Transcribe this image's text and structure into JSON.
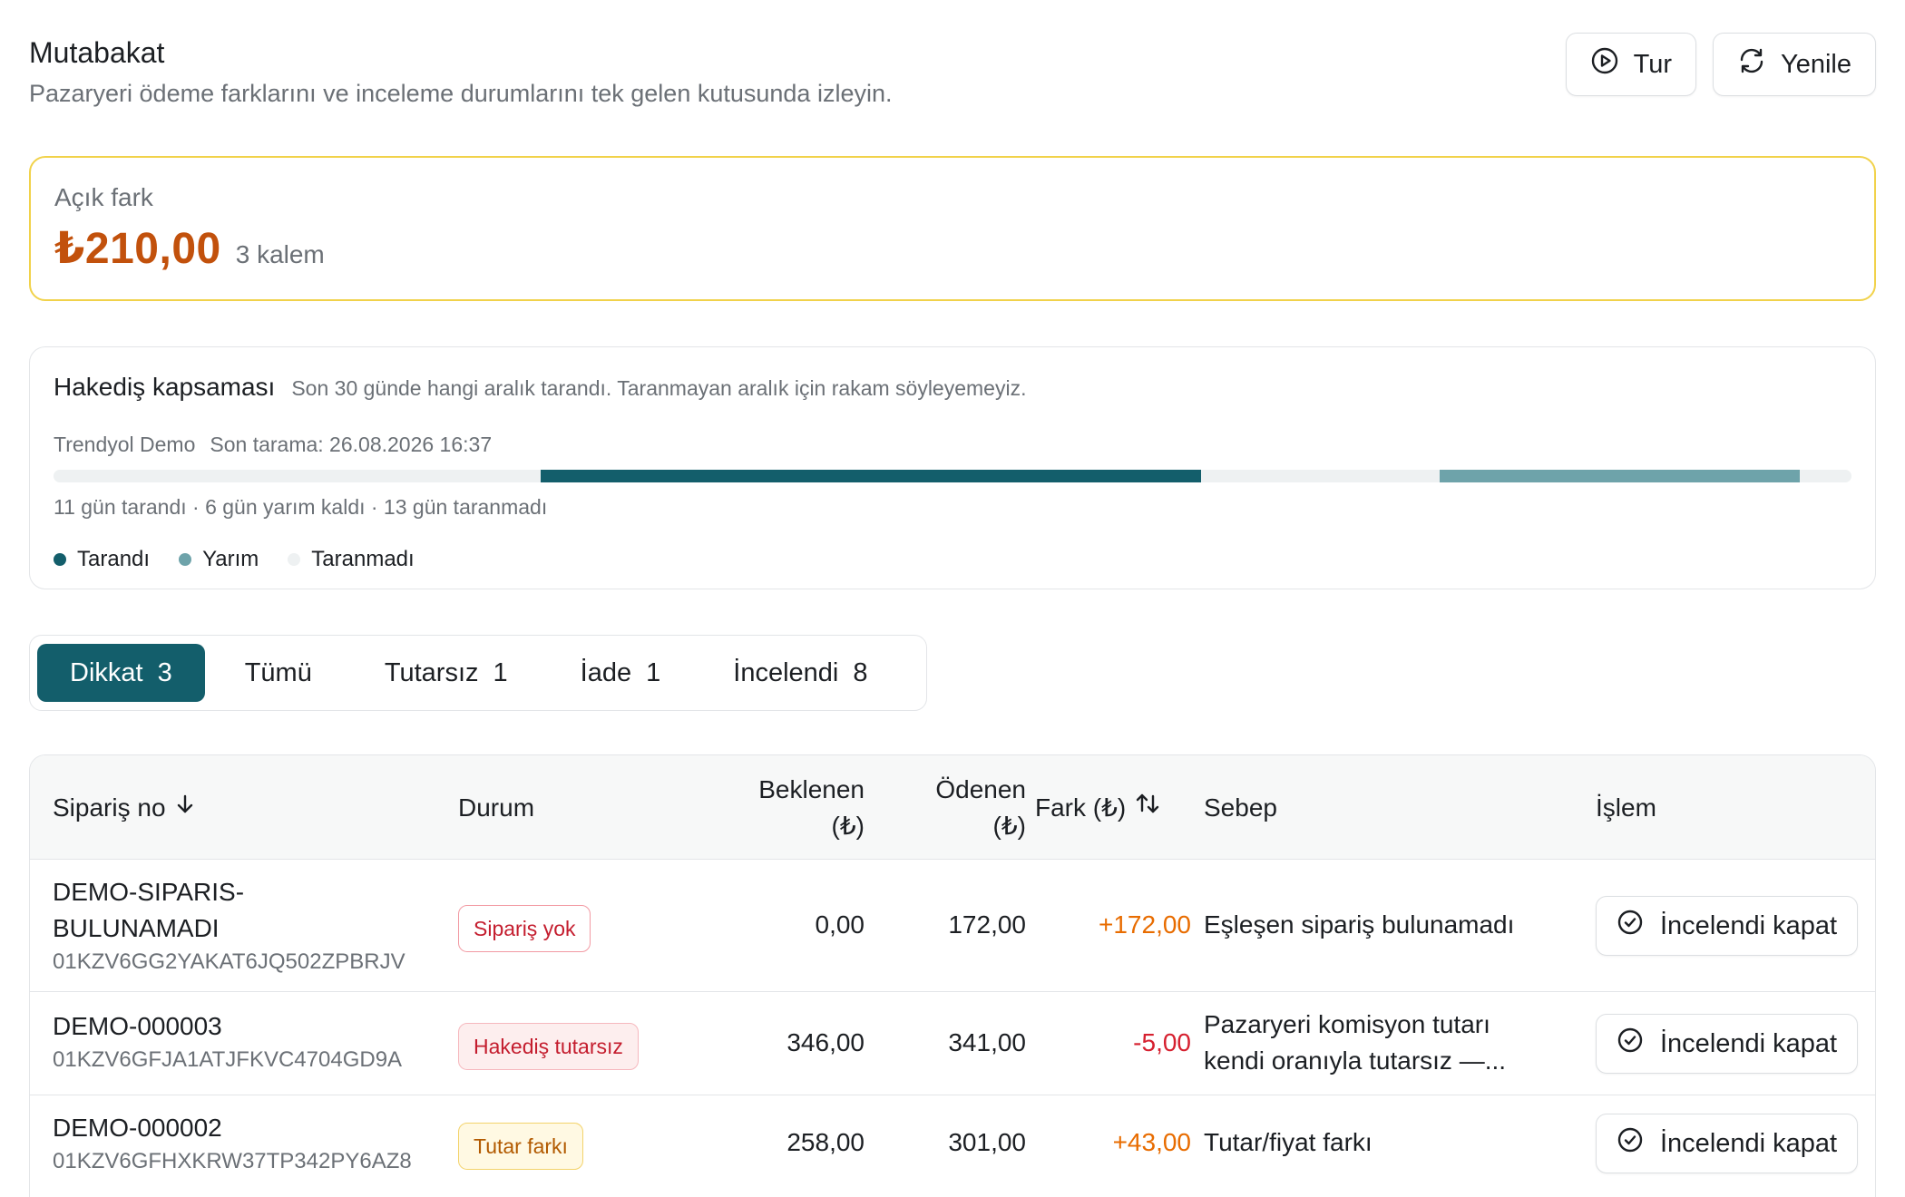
{
  "header": {
    "title": "Mutabakat",
    "subtitle": "Pazaryeri ödeme farklarını ve inceleme durumlarını tek gelen kutusunda izleyin.",
    "tour_label": "Tur",
    "refresh_label": "Yenile"
  },
  "open_diff": {
    "label": "Açık fark",
    "amount": "₺210,00",
    "count": "3 kalem"
  },
  "coverage": {
    "title": "Hakediş kapsaması",
    "description": "Son 30 günde hangi aralık tarandı. Taranmayan aralık için rakam söyleyemeyiz.",
    "store": "Trendyol Demo",
    "last_scan": "Son tarama: 26.08.2026 16:37",
    "summary": "11 gün tarandı · 6 gün yarım kaldı · 13 gün taranmadı",
    "scanned_fraction": 0.367,
    "half_fraction": 0.2,
    "legend": {
      "scanned": "Tarandı",
      "half": "Yarım",
      "not_scanned": "Taranmadı"
    },
    "colors": {
      "scanned": "#135e6b",
      "half": "#6ea3aa",
      "not_scanned": "#eef1f2"
    }
  },
  "tabs": [
    {
      "label": "Dikkat",
      "count": "3"
    },
    {
      "label": "Tümü",
      "count": ""
    },
    {
      "label": "Tutarsız",
      "count": "1"
    },
    {
      "label": "İade",
      "count": "1"
    },
    {
      "label": "İncelendi",
      "count": "8"
    }
  ],
  "table": {
    "columns": {
      "order_no": "Sipariş no",
      "status": "Durum",
      "expected_line1": "Beklenen",
      "expected_line2": "(₺)",
      "paid_line1": "Ödenen",
      "paid_line2": "(₺)",
      "diff": "Fark (₺)",
      "reason": "Sebep",
      "action": "İşlem"
    },
    "rows": [
      {
        "order_line1": "DEMO-SIPARIS-",
        "order_line2": "BULUNAMADI",
        "order_sub": "01KZV6GG2YAKAT6JQ502ZPBRJV",
        "status": "Sipariş yok",
        "expected": "0,00",
        "paid": "172,00",
        "diff": "+172,00",
        "reason_line1": "Eşleşen sipariş bulunamadı",
        "reason_line2": "",
        "action": "İncelendi kapat"
      },
      {
        "order_line1": "DEMO-000003",
        "order_line2": "",
        "order_sub": "01KZV6GFJA1ATJFKVC4704GD9A",
        "status": "Hakediş tutarsız",
        "expected": "346,00",
        "paid": "341,00",
        "diff": "-5,00",
        "reason_line1": "Pazaryeri komisyon tutarı",
        "reason_line2": "kendi oranıyla tutarsız —...",
        "action": "İncelendi kapat"
      },
      {
        "order_line1": "DEMO-000002",
        "order_line2": "",
        "order_sub": "01KZV6GFHXKRW37TP342PY6AZ8",
        "status": "Tutar farkı",
        "expected": "258,00",
        "paid": "301,00",
        "diff": "+43,00",
        "reason_line1": "Tutar/fiyat farkı",
        "reason_line2": "",
        "action": "İncelendi kapat"
      }
    ]
  }
}
